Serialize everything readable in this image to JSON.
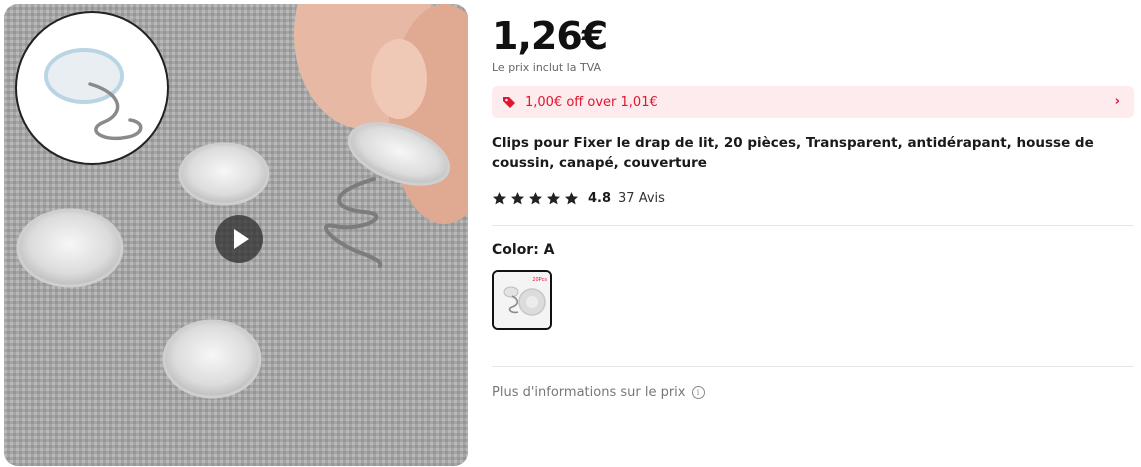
{
  "product": {
    "price": "1,26€",
    "vat_note": "Le prix inclut la TVA",
    "coupon": {
      "text": "1,00€ off over 1,01€",
      "color": "#e0152f",
      "background": "#fdebed"
    },
    "title": "Clips pour Fixer le drap de lit, 20 pièces, Transparent, antidérapant, housse de coussin, canapé, couverture",
    "rating": {
      "stars": 5,
      "value": "4.8",
      "reviews": "37 Avis"
    },
    "color": {
      "label": "Color: A",
      "selected_index": 0,
      "swatch_badge": "20Pcs"
    },
    "more_info": "Plus d'informations sur le prix",
    "icons": {
      "coupon": "tag-icon",
      "chevron": "chevron-right-icon",
      "video": "play-icon",
      "info": "info-icon",
      "rating": "star-icon"
    }
  }
}
